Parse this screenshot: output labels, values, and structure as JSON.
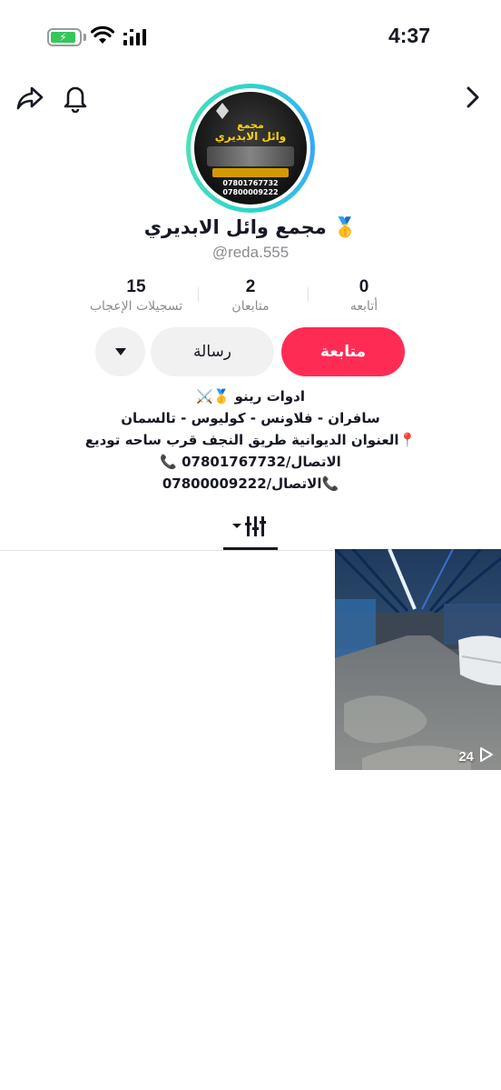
{
  "status_bar": {
    "time": "4:37",
    "battery_charging": true,
    "battery_fraction": 0.9,
    "wifi": "wifi-icon",
    "signal": "cellular-signal-icon"
  },
  "nav": {
    "back_icon": "chevron-right-icon",
    "bell_icon": "bell-icon",
    "share_icon": "share-icon"
  },
  "profile": {
    "display_name": "مجمع وائل الابديري",
    "badge_emoji": "🥇",
    "username": "@reda.555",
    "avatar_text": {
      "line1": "مجمع",
      "line2": "وائل الابديري",
      "phone1": "07801767732",
      "phone2": "07800009222"
    }
  },
  "stats": [
    {
      "value": "0",
      "label": "أتابعه"
    },
    {
      "value": "2",
      "label": "متابعان"
    },
    {
      "value": "15",
      "label": "تسجيلات الإعجاب"
    }
  ],
  "actions": {
    "follow_label": "متابعة",
    "message_label": "رسالة",
    "more_icon": "caret-down-icon"
  },
  "bio": [
    "ادوات رينو 🥇⚔️",
    "سافران - فلاونس - كوليوس - تالسمان",
    "📍العنوان  الديوانية طريق النجف قرب ساحه توديع",
    "الاتصال/07801767732 📞",
    "📞الاتصال/07800009222"
  ],
  "tabs": {
    "active": "videos",
    "icon": "grid-filter-icon"
  },
  "videos": [
    {
      "play_count": "24"
    }
  ],
  "colors": {
    "accent": "#fe2c55",
    "secondary_button": "#f1f1f2",
    "muted_text": "#8a8b91"
  }
}
